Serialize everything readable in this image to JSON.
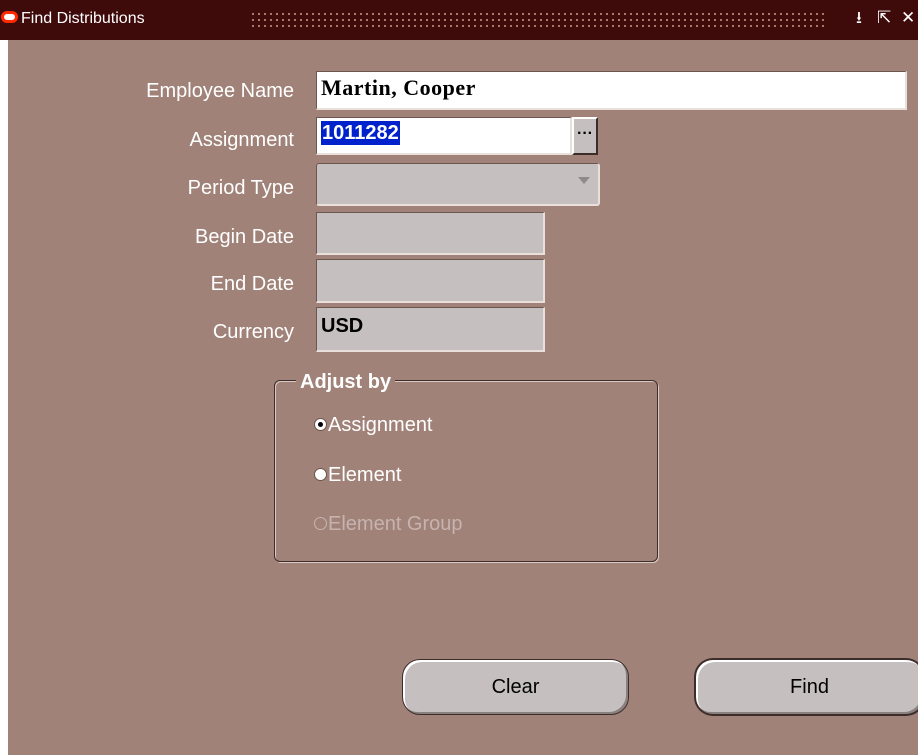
{
  "window": {
    "title": "Find Distributions",
    "minimize_glyph": "⭳",
    "maximize_glyph": "⇱",
    "close_glyph": "✕"
  },
  "form": {
    "employee_name": {
      "label": "Employee Name",
      "value": "Martin, Cooper"
    },
    "assignment": {
      "label": "Assignment",
      "value": "1011282",
      "lov_glyph": "···"
    },
    "period_type": {
      "label": "Period Type",
      "value": ""
    },
    "begin_date": {
      "label": "Begin Date",
      "value": ""
    },
    "end_date": {
      "label": "End Date",
      "value": ""
    },
    "currency": {
      "label": "Currency",
      "value": "USD"
    }
  },
  "adjust_by": {
    "title": "Adjust by",
    "options": [
      {
        "label": "Assignment",
        "selected": true,
        "enabled": true
      },
      {
        "label": "Element",
        "selected": false,
        "enabled": true
      },
      {
        "label": "Element Group",
        "selected": false,
        "enabled": false
      }
    ]
  },
  "buttons": {
    "clear": "Clear",
    "find": "Find"
  },
  "colors": {
    "window_background": "#a08279",
    "title_bar": "#3f0a0a",
    "field_enabled": "#ffffff",
    "field_disabled": "#c5c0bf",
    "selection_highlight": "#0022cc"
  }
}
